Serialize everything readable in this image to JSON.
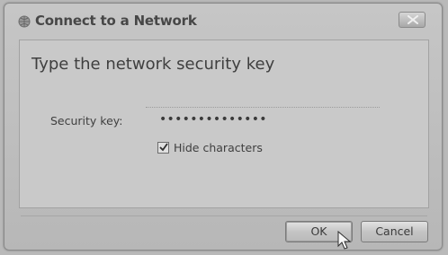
{
  "window": {
    "title": "Connect to a Network"
  },
  "dialog": {
    "heading": "Type the network security key",
    "security_key_label": "Security key:",
    "security_key_value": "••••••••••••••",
    "hide_characters_label": "Hide characters",
    "hide_characters_checked": true
  },
  "buttons": {
    "ok_label": "OK",
    "cancel_label": "Cancel"
  },
  "icons": {
    "title": "network-globe-icon",
    "close": "close-icon",
    "checkbox": "checkmark-icon",
    "cursor": "mouse-pointer-icon"
  }
}
